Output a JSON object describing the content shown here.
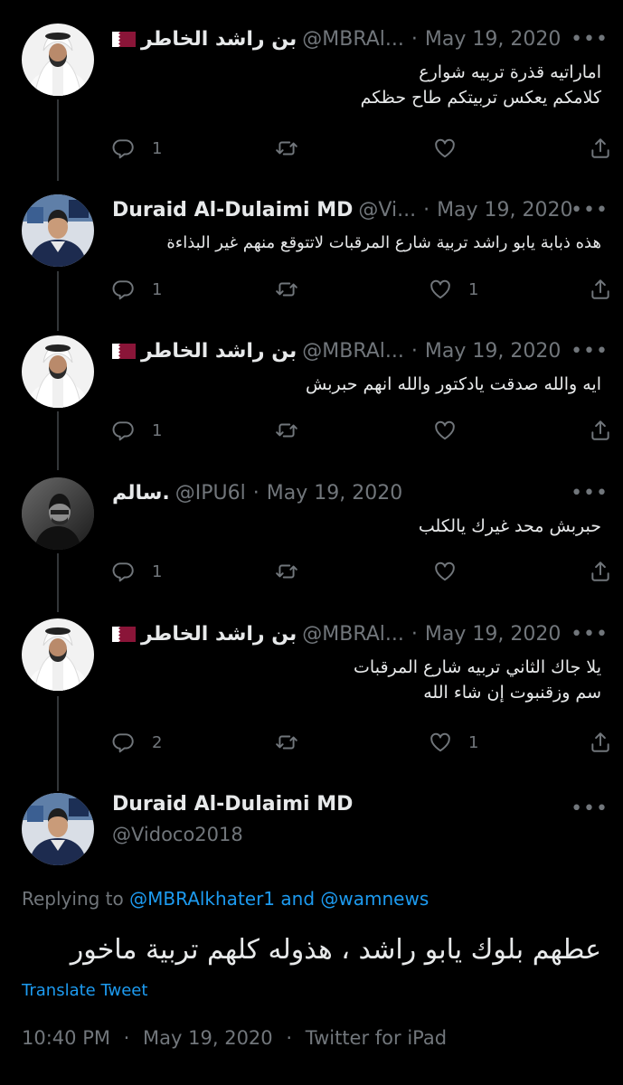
{
  "replies": [
    {
      "name": "بن راشد الخاطر",
      "flag": "qatar-flag-icon",
      "handle": "@MBRAl...",
      "date": "May 19, 2020",
      "lines": [
        "اماراتيه قذرة تربيه شوارع",
        "كلامكم يعكس تربيتكم طاح حظكم"
      ],
      "reply_count": "1",
      "retweet_count": "",
      "like_count": ""
    },
    {
      "name": "Duraid Al-Dulaimi MD",
      "handle": "@Vi...",
      "date": "May 19, 2020",
      "lines": [
        "هذه ذبابة يابو راشد تربية شارع المرقبات لاتتوقع منهم غير البذاءة"
      ],
      "reply_count": "1",
      "retweet_count": "",
      "like_count": "1"
    },
    {
      "name": "بن راشد الخاطر",
      "flag": "qatar-flag-icon",
      "handle": "@MBRAl...",
      "date": "May 19, 2020",
      "lines": [
        "ايه والله صدقت يادكتور والله انهم حبربش"
      ],
      "reply_count": "1",
      "retweet_count": "",
      "like_count": ""
    },
    {
      "name": "سالم.",
      "handle": "@IPU6l",
      "date": "May 19, 2020",
      "lines": [
        "حبربش محد غيرك يالكلب"
      ],
      "reply_count": "1",
      "retweet_count": "",
      "like_count": ""
    },
    {
      "name": "بن راشد الخاطر",
      "flag": "qatar-flag-icon",
      "handle": "@MBRAl...",
      "date": "May 19, 2020",
      "lines": [
        "يلا جاك الثاني تربيه شارع المرقبات",
        "سم وزقنبوت إن شاء الله"
      ],
      "reply_count": "2",
      "retweet_count": "",
      "like_count": "1"
    }
  ],
  "main_tweet": {
    "name": "Duraid Al-Dulaimi MD",
    "handle": "@Vidoco2018",
    "replying_prefix": "Replying to",
    "replying_to_1": "@MBRAlkhater1",
    "replying_and": "and",
    "replying_to_2": "@wamnews",
    "text": "عطهم بلوك يابو راشد ، هذوله كلهم تربية ماخور",
    "translate_label": "Translate Tweet",
    "time": "10:40 PM",
    "date": "May 19, 2020",
    "source": "Twitter for iPad",
    "separator": "·",
    "more": "•••"
  },
  "icons": {
    "reply": "reply-icon",
    "retweet": "retweet-icon",
    "like": "like-icon",
    "share": "share-icon",
    "more": "more-icon"
  },
  "colors": {
    "background": "#000000",
    "text": "#e7e9ea",
    "muted": "#71767b",
    "link": "#1d9bf0",
    "thread_line": "#333639"
  }
}
